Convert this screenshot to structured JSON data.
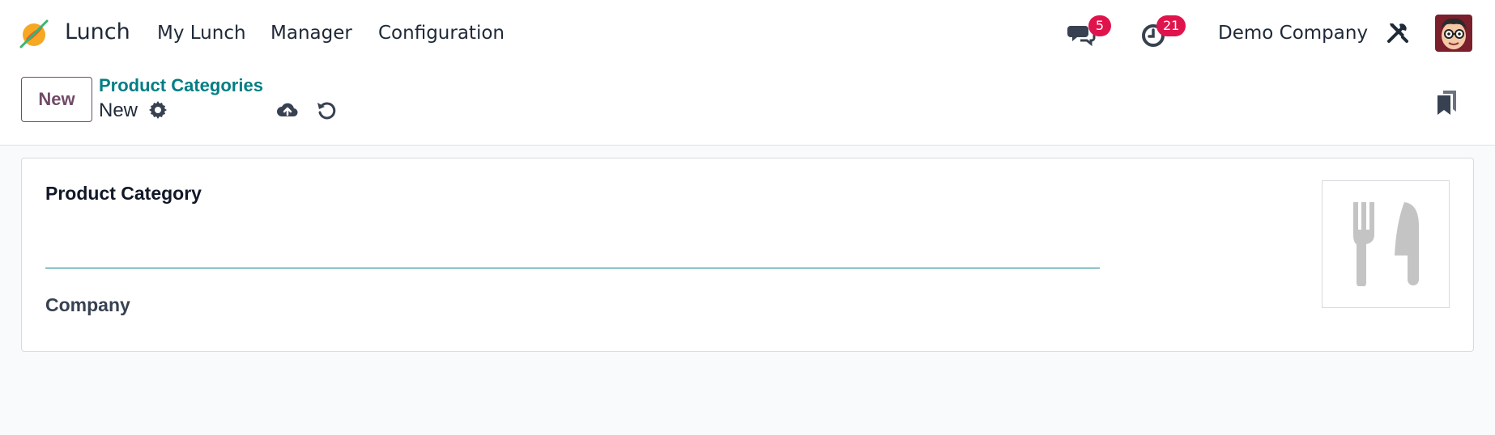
{
  "navbar": {
    "app_name": "Lunch",
    "menu": [
      "My Lunch",
      "Manager",
      "Configuration"
    ],
    "messages_badge": "5",
    "activities_badge": "21",
    "company": "Demo Company",
    "icons": {
      "app_logo": "lunch-app-logo",
      "messages": "chat-bubbles-icon",
      "activities": "clock-icon",
      "debug": "tools-icon",
      "avatar": "user-avatar"
    }
  },
  "control_panel": {
    "new_button": "New",
    "breadcrumb_parent": "Product Categories",
    "breadcrumb_current": "New",
    "icons": [
      "gear-icon",
      "cloud-upload-icon",
      "discard-icon",
      "bookmark-icon"
    ]
  },
  "form": {
    "title_label": "Product Category",
    "name_value": "",
    "company_label": "Company",
    "image_placeholder": "fork-knife-icon"
  },
  "colors": {
    "brand": "#714b67",
    "accent": "#017e84",
    "badge": "#e0144c"
  }
}
